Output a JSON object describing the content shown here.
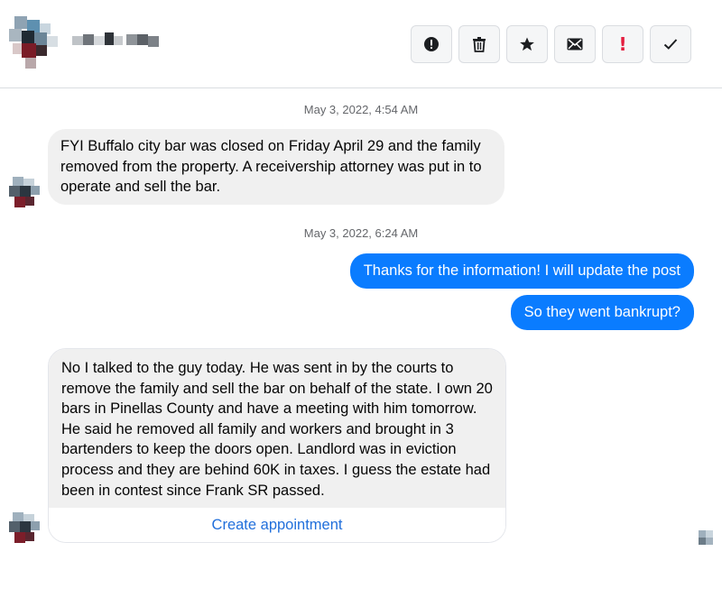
{
  "conversation": {
    "actions": [
      {
        "name": "report-button",
        "icon": "alert-circle-icon"
      },
      {
        "name": "delete-button",
        "icon": "trash-icon"
      },
      {
        "name": "star-button",
        "icon": "star-icon"
      },
      {
        "name": "mark-unread-button",
        "icon": "envelope-icon"
      },
      {
        "name": "spam-button",
        "icon": "exclamation-icon"
      },
      {
        "name": "done-button",
        "icon": "checkmark-icon"
      }
    ],
    "timestamps": [
      "May 3, 2022, 4:54 AM",
      "May 3, 2022, 6:24 AM"
    ],
    "messages": {
      "m1": "FYI Buffalo city bar was closed on Friday April 29 and the family removed from the property.  A receivership attorney was put in to operate and sell the bar.",
      "m2": "Thanks for the information! I will update the post",
      "m3": "So they went bankrupt?",
      "m4_part1": "No  I talked to the guy today.  He was sent in by the courts to remove the family and sell the bar on behalf of the state.  I own 20 bars in Pinellas County and have a meeting with him ",
      "m4_link1": "tomorrow",
      "m4_part2": ".  He said he removed all family and workers and brought ",
      "m4_link2": "in 3",
      "m4_part3": " bartenders to keep the doors open.  Landlord was in eviction process and they are behind 60K in taxes.  I guess the estate had been in contest since Frank SR passed."
    },
    "create_appointment_label": "Create appointment"
  },
  "colors": {
    "outgoing_bubble": "#0a7cff",
    "incoming_bubble": "#f0f0f0",
    "link": "#216fdb",
    "spam_icon": "#e41e3f"
  }
}
